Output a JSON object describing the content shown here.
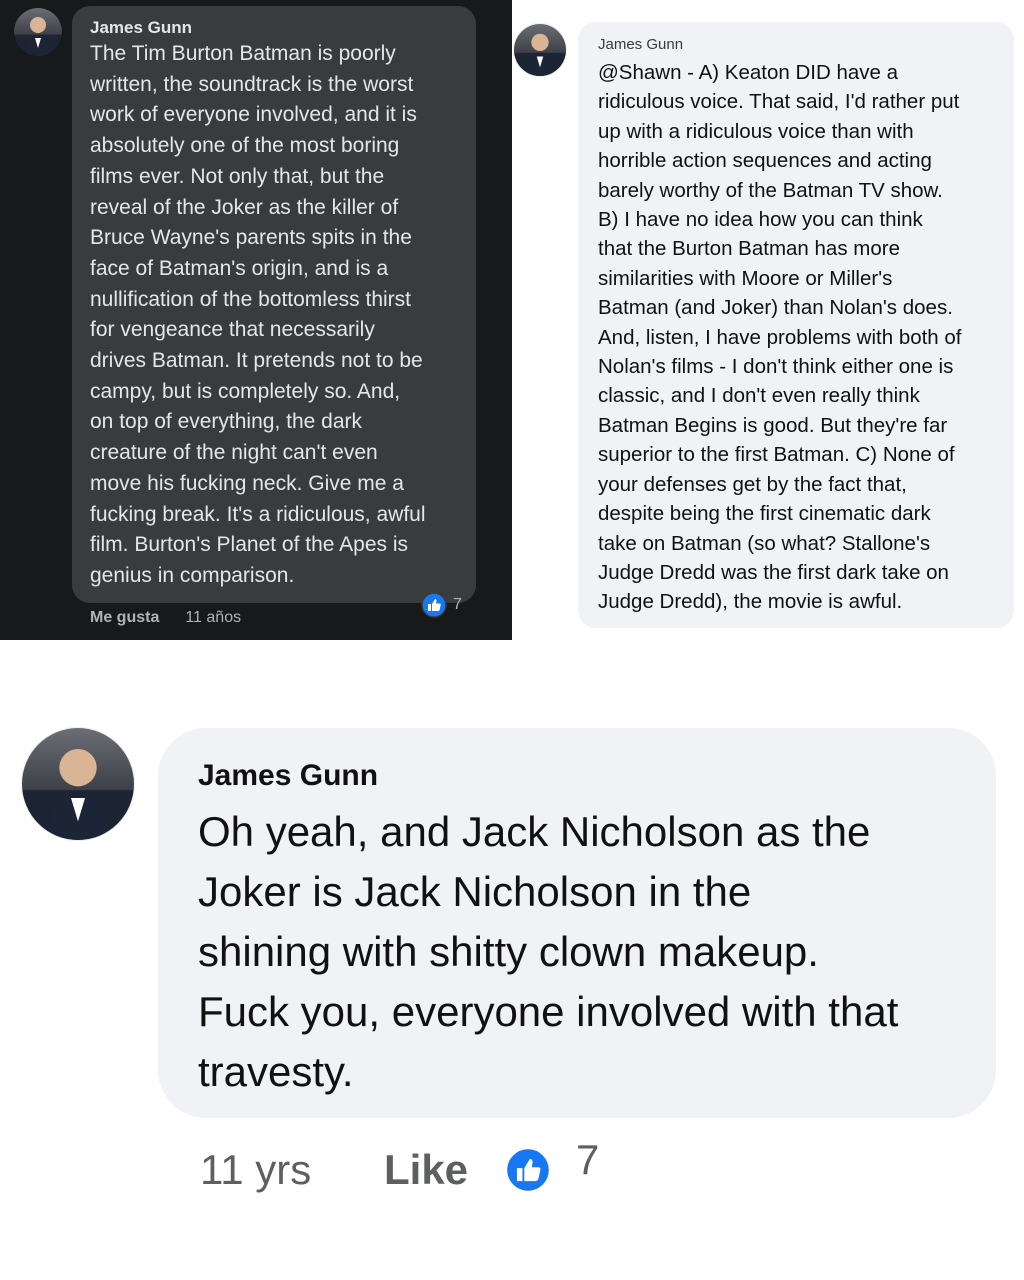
{
  "colors": {
    "dark_bg": "#18191a",
    "dark_bubble": "#3a3b3c",
    "light_bubble": "#f0f2f5",
    "like_blue": "#1877f2"
  },
  "panel_dark": {
    "author": "James Gunn",
    "text": "The Tim Burton Batman is poorly\nwritten, the soundtrack is the worst\nwork of everyone involved, and it is\nabsolutely one of the most boring\nfilms ever. Not only that, but the\nreveal of the Joker as the killer of\nBruce Wayne's parents spits in the\nface of Batman's origin, and is a\nnullification of the bottomless thirst\nfor vengeance that necessarily\ndrives Batman. It pretends not to be\ncampy, but is completely so. And,\non top of everything, the dark\ncreature of the night can't even\nmove his fucking neck. Give me a\nfucking break. It's a ridiculous, awful\nfilm. Burton's Planet of the Apes is\ngenius in comparison.",
    "reaction_icon": "like-icon",
    "reaction_count": "7",
    "like_label": "Me gusta",
    "timestamp": "11 años"
  },
  "panel_light": {
    "author": "James Gunn",
    "text": "@Shawn - A) Keaton DID have a\nridiculous voice. That said, I'd rather put\nup with a ridiculous voice than with\nhorrible action sequences and acting\nbarely worthy of the Batman TV show.\nB) I have no idea how you can think\nthat the Burton Batman has more\nsimilarities with Moore or Miller's\nBatman (and Joker) than Nolan's does.\nAnd, listen, I have problems with both of\nNolan's films - I don't think either one is\nclassic, and I don't even really think\nBatman Begins is good.  But they're far\nsuperior to the first Batman. C) None of\nyour defenses get by the fact that,\ndespite being the first cinematic dark\ntake on Batman (so what? Stallone's\nJudge Dredd was the first dark take on\nJudge Dredd), the movie is awful."
  },
  "panel_big": {
    "author": "James Gunn",
    "text": "Oh yeah, and Jack Nicholson as the\nJoker is Jack Nicholson in the\nshining with shitty clown makeup.\nFuck you, everyone involved with that\ntravesty.",
    "timestamp": "11 yrs",
    "like_label": "Like",
    "reaction_icon": "like-icon",
    "reaction_count": "7"
  }
}
